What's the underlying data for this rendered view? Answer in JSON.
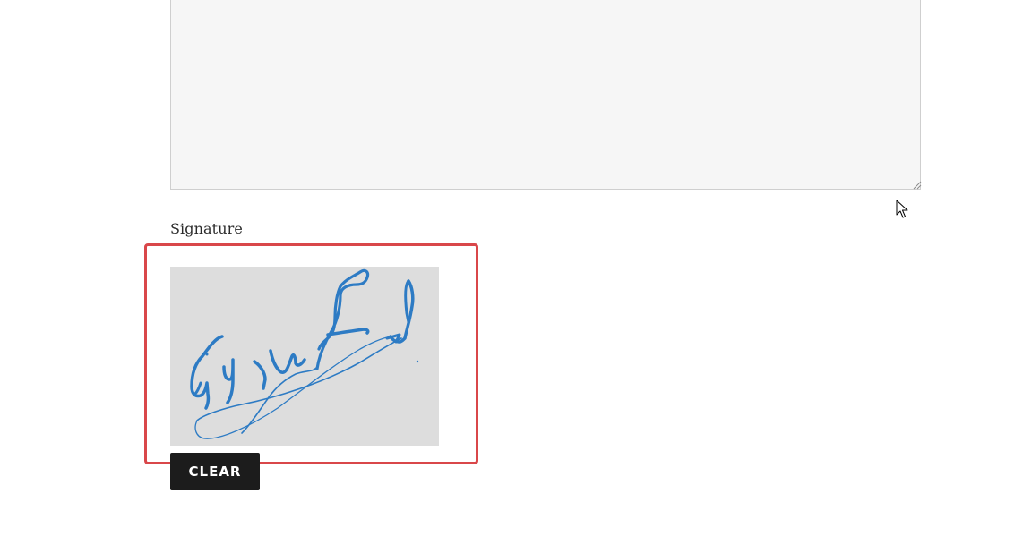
{
  "form": {
    "message_field": {
      "value": "",
      "placeholder": ""
    },
    "signature": {
      "label": "Signature",
      "pad_background": "#dddddd",
      "ink_color": "#2d7bc4",
      "highlight_color": "#d9474a"
    },
    "clear_button": {
      "label": "CLEAR"
    }
  }
}
